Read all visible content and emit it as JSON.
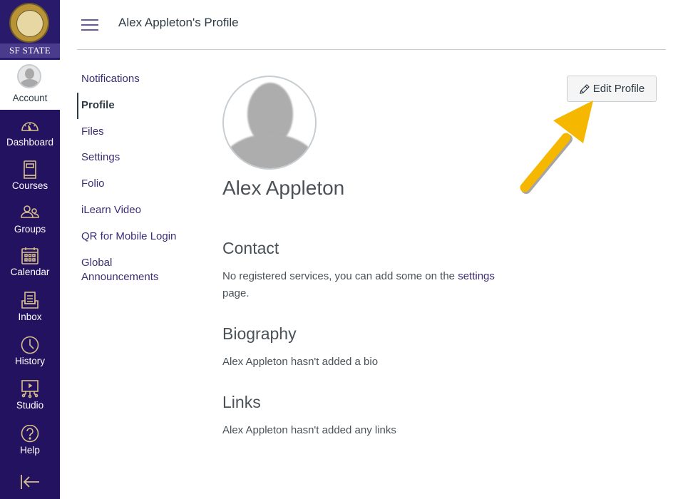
{
  "brand": {
    "logo_text": "SF STATE",
    "nav_bg": "#231260",
    "icon_color": "#d8c08a",
    "accent": "#3d2d75",
    "arrow_color": "#f6b700"
  },
  "global_nav": {
    "account": {
      "label": "Account",
      "icon": "avatar-icon"
    },
    "items": [
      {
        "label": "Dashboard",
        "icon": "dashboard-icon"
      },
      {
        "label": "Courses",
        "icon": "courses-icon"
      },
      {
        "label": "Groups",
        "icon": "groups-icon"
      },
      {
        "label": "Calendar",
        "icon": "calendar-icon"
      },
      {
        "label": "Inbox",
        "icon": "inbox-icon"
      },
      {
        "label": "History",
        "icon": "history-icon"
      },
      {
        "label": "Studio",
        "icon": "studio-icon"
      },
      {
        "label": "Help",
        "icon": "help-icon"
      }
    ],
    "collapse_icon": "collapse-arrow-icon"
  },
  "header": {
    "title": "Alex Appleton's Profile"
  },
  "subnav": {
    "items": [
      {
        "label": "Notifications"
      },
      {
        "label": "Profile",
        "active": true
      },
      {
        "label": "Files"
      },
      {
        "label": "Settings"
      },
      {
        "label": "Folio"
      },
      {
        "label": "iLearn Video"
      },
      {
        "label": "QR for Mobile Login"
      },
      {
        "label": "Global",
        "label2": "Announcements"
      }
    ]
  },
  "profile": {
    "name": "Alex Appleton",
    "edit_button": "Edit Profile",
    "contact": {
      "heading": "Contact",
      "text_before": "No registered services, you can add some on the ",
      "link": "settings",
      "text_after": "page."
    },
    "biography": {
      "heading": "Biography",
      "text": "Alex Appleton hasn't added a bio"
    },
    "links": {
      "heading": "Links",
      "text": "Alex Appleton hasn't added any links"
    }
  }
}
